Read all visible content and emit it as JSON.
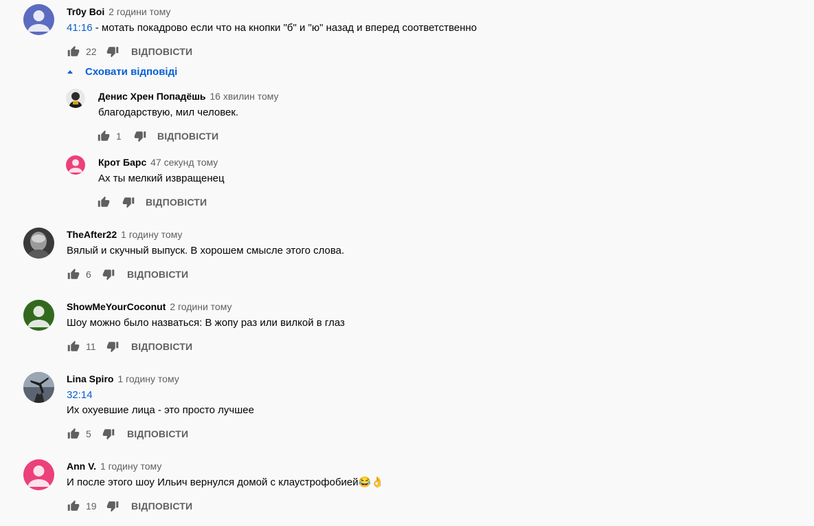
{
  "reply_label": "ВІДПОВІСТИ",
  "hide_replies_label": "Сховати відповіді",
  "comments": [
    {
      "author": "Tr0y Boi",
      "time": "2 години тому",
      "timestamp": "41:16",
      "text": " - мотать покадрово если что на кнопки \"б\" и \"ю\" назад и вперед соответственно",
      "likes": "22",
      "avatar_color": "#5c6bc0"
    },
    {
      "author": "Денис Хрен Попадёшь",
      "time": "16 хвилин тому",
      "text": "благодарствую, мил человек.",
      "likes": "1"
    },
    {
      "author": "Крот Барс",
      "time": "47 секунд тому",
      "text": "Ах ты мелкий извращенец",
      "likes": "",
      "avatar_color": "#ec407a"
    },
    {
      "author": "TheAfter22",
      "time": "1 годину тому",
      "text": "Вялый и скучный выпуск. В хорошем смысле этого слова.",
      "likes": "6"
    },
    {
      "author": "ShowMeYourCoconut",
      "time": "2 години тому",
      "text": "Шоу можно было назваться: В жопу раз или вилкой в глаз",
      "likes": "11",
      "avatar_color": "#33691e"
    },
    {
      "author": "Lina Spiro",
      "time": "1 годину тому",
      "timestamp": "32:14",
      "text": "Их охуевшие лица - это просто лучшее",
      "likes": "5"
    },
    {
      "author": "Ann V.",
      "time": "1 годину тому",
      "text": "И после этого шоу Ильич вернулся домой с клаустрофобией😂👌",
      "likes": "19",
      "avatar_color": "#ec407a"
    }
  ]
}
